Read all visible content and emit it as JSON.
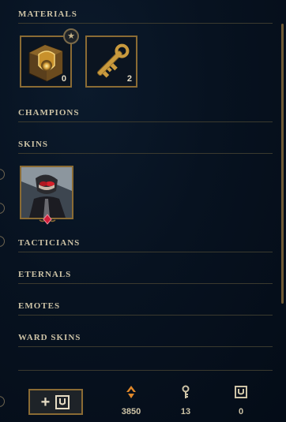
{
  "sections": {
    "materials": "MATERIALS",
    "champions": "CHAMPIONS",
    "skins": "SKINS",
    "tacticians": "TACTICIANS",
    "eternals": "ETERNALS",
    "emotes": "EMOTES",
    "ward_skins": "WARD SKINS"
  },
  "materials": [
    {
      "icon": "hextech-chest-icon",
      "count": "0"
    },
    {
      "icon": "hextech-key-icon",
      "count": "2"
    }
  ],
  "skins": [
    {
      "icon": "champion-skin-portrait"
    }
  ],
  "footer": {
    "add_button_label": "+",
    "currencies": [
      {
        "icon": "orange-essence-icon",
        "amount": "3850"
      },
      {
        "icon": "key-fragment-icon",
        "amount": "13"
      },
      {
        "icon": "chest-icon",
        "amount": "0"
      }
    ]
  },
  "colors": {
    "accent_gold": "#8a6b34",
    "essence_orange": "#e0882a",
    "text": "#cdc3a6",
    "background": "#071220"
  }
}
